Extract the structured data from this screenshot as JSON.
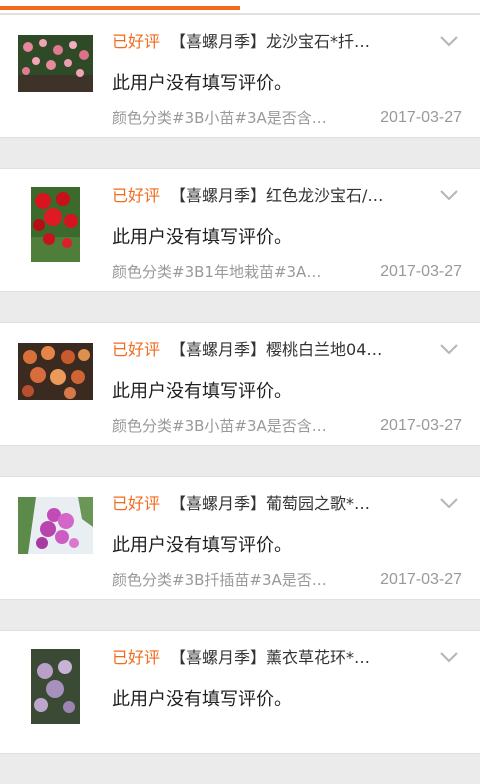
{
  "progress": {
    "fraction": 0.5
  },
  "colors": {
    "accent": "#f26a1b",
    "text": "#1f1f1f",
    "muted": "#999999",
    "background": "#ebebeb"
  },
  "reviews": [
    {
      "rating_label": "已好评",
      "product_title": "【喜螺月季】龙沙宝石*扦…",
      "comment": "此用户没有填写评价。",
      "sku": "颜色分类#3B小苗#3A是否含…",
      "date": "2017-03-27",
      "thumb_icon": "pink-climbing-rose-photo"
    },
    {
      "rating_label": "已好评",
      "product_title": "【喜螺月季】红色龙沙宝石/…",
      "comment": "此用户没有填写评价。",
      "sku": "颜色分类#3B1年地栽苗#3A…",
      "date": "2017-03-27",
      "thumb_icon": "red-rose-photo"
    },
    {
      "rating_label": "已好评",
      "product_title": "【喜螺月季】樱桃白兰地04…",
      "comment": "此用户没有填写评价。",
      "sku": "颜色分类#3B小苗#3A是否含…",
      "date": "2017-03-27",
      "thumb_icon": "orange-rose-photo"
    },
    {
      "rating_label": "已好评",
      "product_title": "【喜螺月季】葡萄园之歌*…",
      "comment": "此用户没有填写评价。",
      "sku": "颜色分类#3B扦插苗#3A是否…",
      "date": "2017-03-27",
      "thumb_icon": "purple-rose-photo"
    },
    {
      "rating_label": "已好评",
      "product_title": "【喜螺月季】薰衣草花环*…",
      "comment": "此用户没有填写评价。",
      "sku": "",
      "date": "",
      "thumb_icon": "lavender-rose-photo"
    }
  ]
}
